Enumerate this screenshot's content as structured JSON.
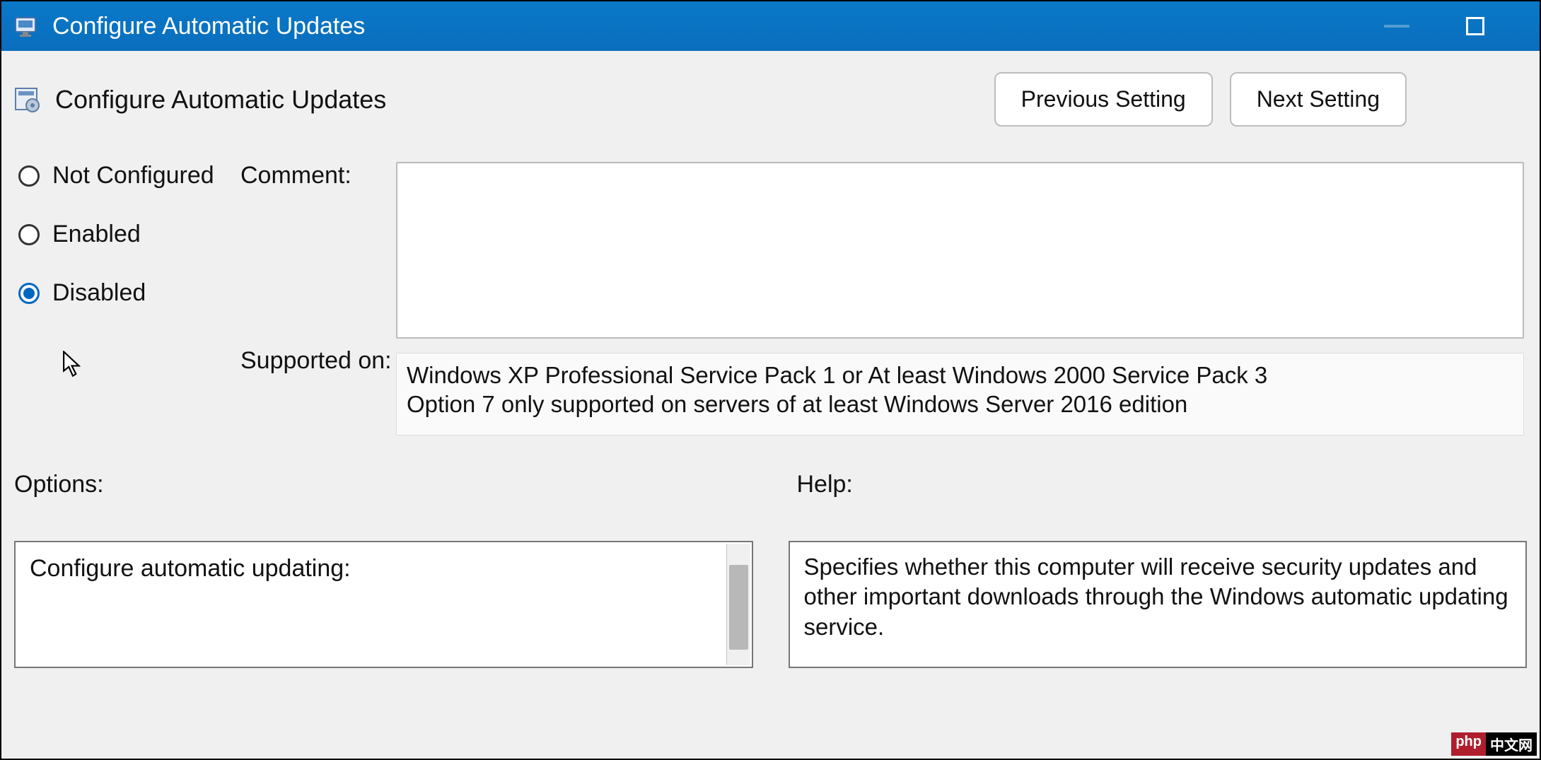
{
  "titlebar": {
    "title": "Configure Automatic Updates"
  },
  "header": {
    "heading": "Configure Automatic Updates",
    "prev_button": "Previous Setting",
    "next_button": "Next Setting"
  },
  "radios": {
    "not_configured": "Not Configured",
    "enabled": "Enabled",
    "disabled": "Disabled",
    "selected": "disabled"
  },
  "labels": {
    "comment": "Comment:",
    "supported_on": "Supported on:",
    "options": "Options:",
    "help": "Help:"
  },
  "fields": {
    "comment_value": "",
    "supported_on_text": "Windows XP Professional Service Pack 1 or At least Windows 2000 Service Pack 3\nOption 7 only supported on servers of at least Windows Server 2016 edition"
  },
  "options": {
    "title": "Configure automatic updating:"
  },
  "help": {
    "body": "Specifies whether this computer will receive security updates and other important downloads through the Windows automatic updating service."
  },
  "watermark": {
    "a": "php",
    "b": "中文网"
  }
}
